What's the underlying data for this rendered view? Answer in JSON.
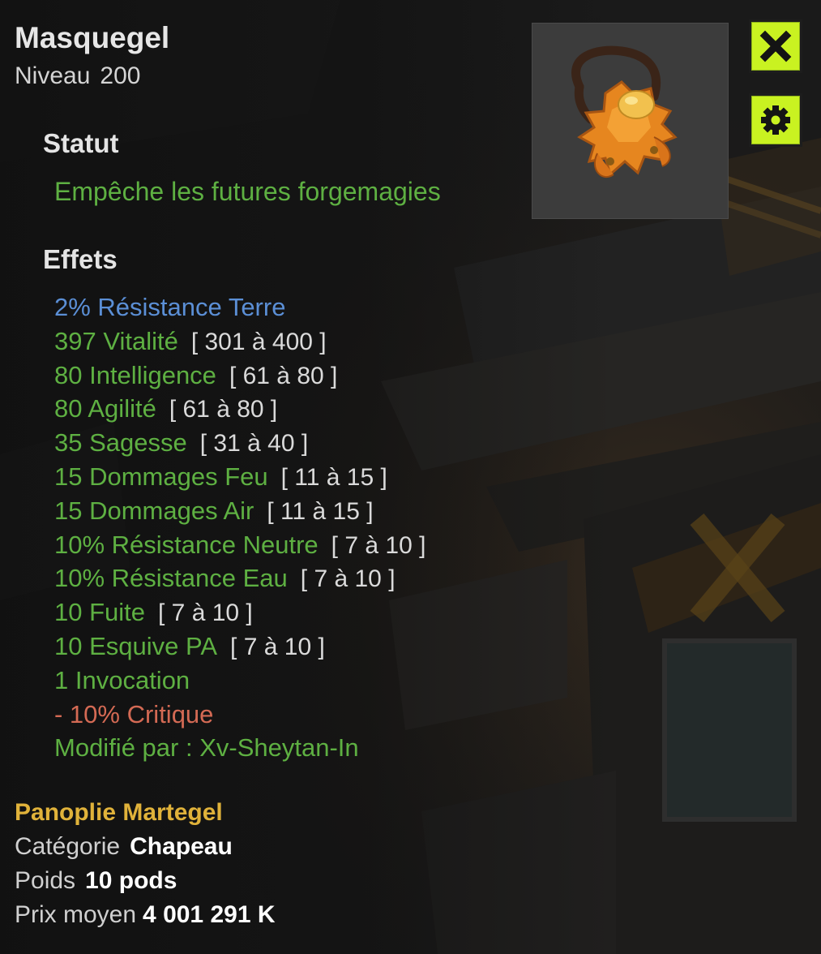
{
  "item": {
    "name": "Masquegel",
    "level_label": "Niveau",
    "level_value": "200"
  },
  "status": {
    "heading": "Statut",
    "text": "Empêche les futures forgemagies"
  },
  "effects": {
    "heading": "Effets",
    "lines": [
      {
        "text": "2% Résistance Terre",
        "range": "",
        "kind": "info"
      },
      {
        "text": "397 Vitalité",
        "range": "[ 301 à 400 ]",
        "kind": "pos"
      },
      {
        "text": "80 Intelligence",
        "range": "[ 61 à 80 ]",
        "kind": "pos"
      },
      {
        "text": "80 Agilité",
        "range": "[ 61 à 80 ]",
        "kind": "pos"
      },
      {
        "text": "35 Sagesse",
        "range": "[ 31 à 40 ]",
        "kind": "pos"
      },
      {
        "text": "15 Dommages Feu",
        "range": "[ 11 à 15 ]",
        "kind": "pos"
      },
      {
        "text": "15 Dommages Air",
        "range": "[ 11 à 15 ]",
        "kind": "pos"
      },
      {
        "text": "10% Résistance Neutre",
        "range": "[ 7 à 10 ]",
        "kind": "pos"
      },
      {
        "text": "10% Résistance Eau",
        "range": "[ 7 à 10 ]",
        "kind": "pos"
      },
      {
        "text": "10 Fuite",
        "range": "[ 7 à 10 ]",
        "kind": "pos"
      },
      {
        "text": "10 Esquive PA",
        "range": "[ 7 à 10 ]",
        "kind": "pos"
      },
      {
        "text": "1 Invocation",
        "range": "",
        "kind": "pos"
      },
      {
        "text": "- 10% Critique",
        "range": "",
        "kind": "neg"
      },
      {
        "text": "Modifié par : Xv-Sheytan-In",
        "range": "",
        "kind": "pos"
      }
    ]
  },
  "details": {
    "set_name": "Panoplie Martegel",
    "category_label": "Catégorie",
    "category_value": "Chapeau",
    "weight_label": "Poids",
    "weight_value": "10 pods",
    "price_label": "Prix moyen",
    "price_value": "4 001 291 K"
  },
  "buttons": {
    "close_icon": "close-icon",
    "settings_icon": "gear-icon"
  },
  "colors": {
    "effect_positive": "#5eb042",
    "effect_negative": "#d46a54",
    "effect_info": "#5b8fd6",
    "set_name": "#e0b23a",
    "button_accent": "#c9f221"
  }
}
